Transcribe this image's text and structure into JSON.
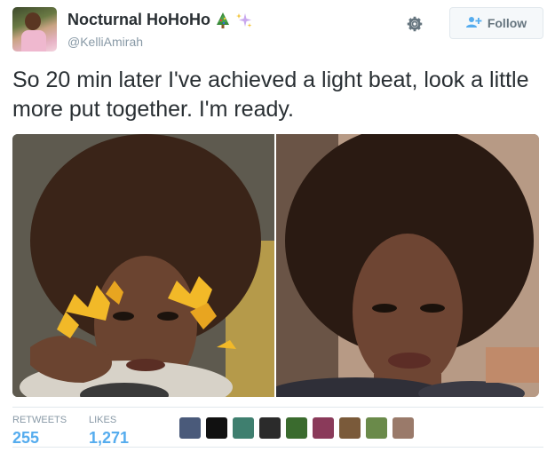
{
  "author": {
    "display_name": "Nocturnal HoHoHo",
    "handle": "@KelliAmirah",
    "emojis": [
      "christmas-tree-icon",
      "sparkles-icon"
    ]
  },
  "actions": {
    "follow_label": "Follow"
  },
  "tweet": {
    "text": "So 20 min later I've achieved a light beat, look a little more put together. I'm ready."
  },
  "stats": {
    "retweets_label": "RETWEETS",
    "retweets_value": "255",
    "likes_label": "LIKES",
    "likes_value": "1,271"
  },
  "likers": [
    {
      "color": "#4a5a7a"
    },
    {
      "color": "#111111"
    },
    {
      "color": "#3f7f6f"
    },
    {
      "color": "#2b2b2b"
    },
    {
      "color": "#3a6b2e"
    },
    {
      "color": "#8a3a5a"
    },
    {
      "color": "#7a5a3a"
    },
    {
      "color": "#6a8a4a"
    },
    {
      "color": "#9a7a6a"
    }
  ],
  "colors": {
    "link_blue": "#55acee",
    "secondary_gray": "#8899a6",
    "text": "#292f33"
  }
}
